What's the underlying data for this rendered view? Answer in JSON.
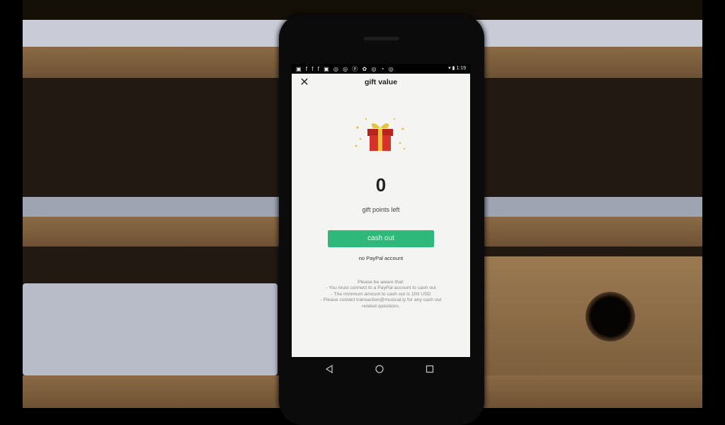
{
  "statusbar": {
    "icons": "▣ f f f ▣ ◎ ◎ ⓟ ✿ ◎ ◔ ◎",
    "time": "1:19"
  },
  "header": {
    "title": "gift value"
  },
  "gift": {
    "points": "0",
    "points_label": "gift points left"
  },
  "actions": {
    "cash_out_label": "cash out",
    "paypal_status": "no PayPal account"
  },
  "notes": {
    "line1": "Please be aware that:",
    "line2": "- You must connect to a PayPal account to cash out",
    "line3": "- The minimum amount to cash out is 100 USD",
    "line4": "- Please contact transaction@musical.ly for any cash out",
    "line5": "related questions."
  },
  "colors": {
    "accent": "#2eb97a",
    "gift_box": "#d6322a",
    "ribbon": "#e8c23a"
  }
}
